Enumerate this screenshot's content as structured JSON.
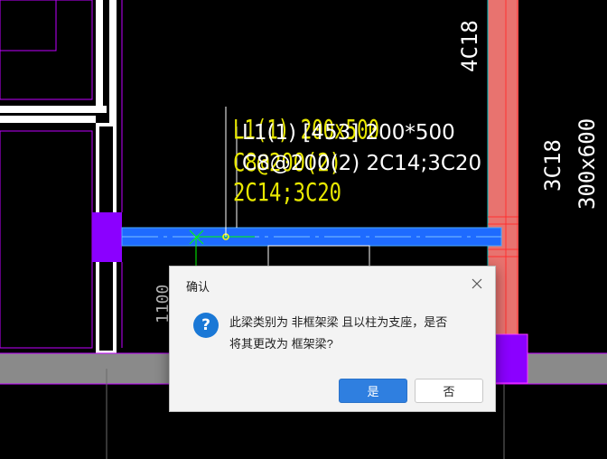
{
  "cad": {
    "column_label_top": "4C18",
    "column_label_right_1": "3C18",
    "column_label_right_2": "300x600",
    "beam_label_yellow_1": "L1(1) 200x500",
    "beam_label_yellow_2": "C8@200(2)",
    "beam_label_yellow_3": "2C14;3C20",
    "beam_label_white_1": "L1(1) [453] 200*500",
    "beam_label_white_2": "C8@200(2) 2C14;3C20",
    "left_vertical_label": "1100"
  },
  "dialog": {
    "title": "确认",
    "icon": "question-icon",
    "message_line1": "此梁类别为 非框架梁 且以柱为支座，是否",
    "message_line2": "将其更改为 框架梁?",
    "yes_label": "是",
    "no_label": "否"
  },
  "colors": {
    "background": "#000000",
    "wall_white": "#ffffff",
    "column_magenta": "#8b00ff",
    "beam_blue": "#1e6bff",
    "column_red": "#e8736f",
    "yellow_text": "#e8e800",
    "floor_gray": "#8a8a8a",
    "dialog_button_primary": "#2f7fe0"
  }
}
